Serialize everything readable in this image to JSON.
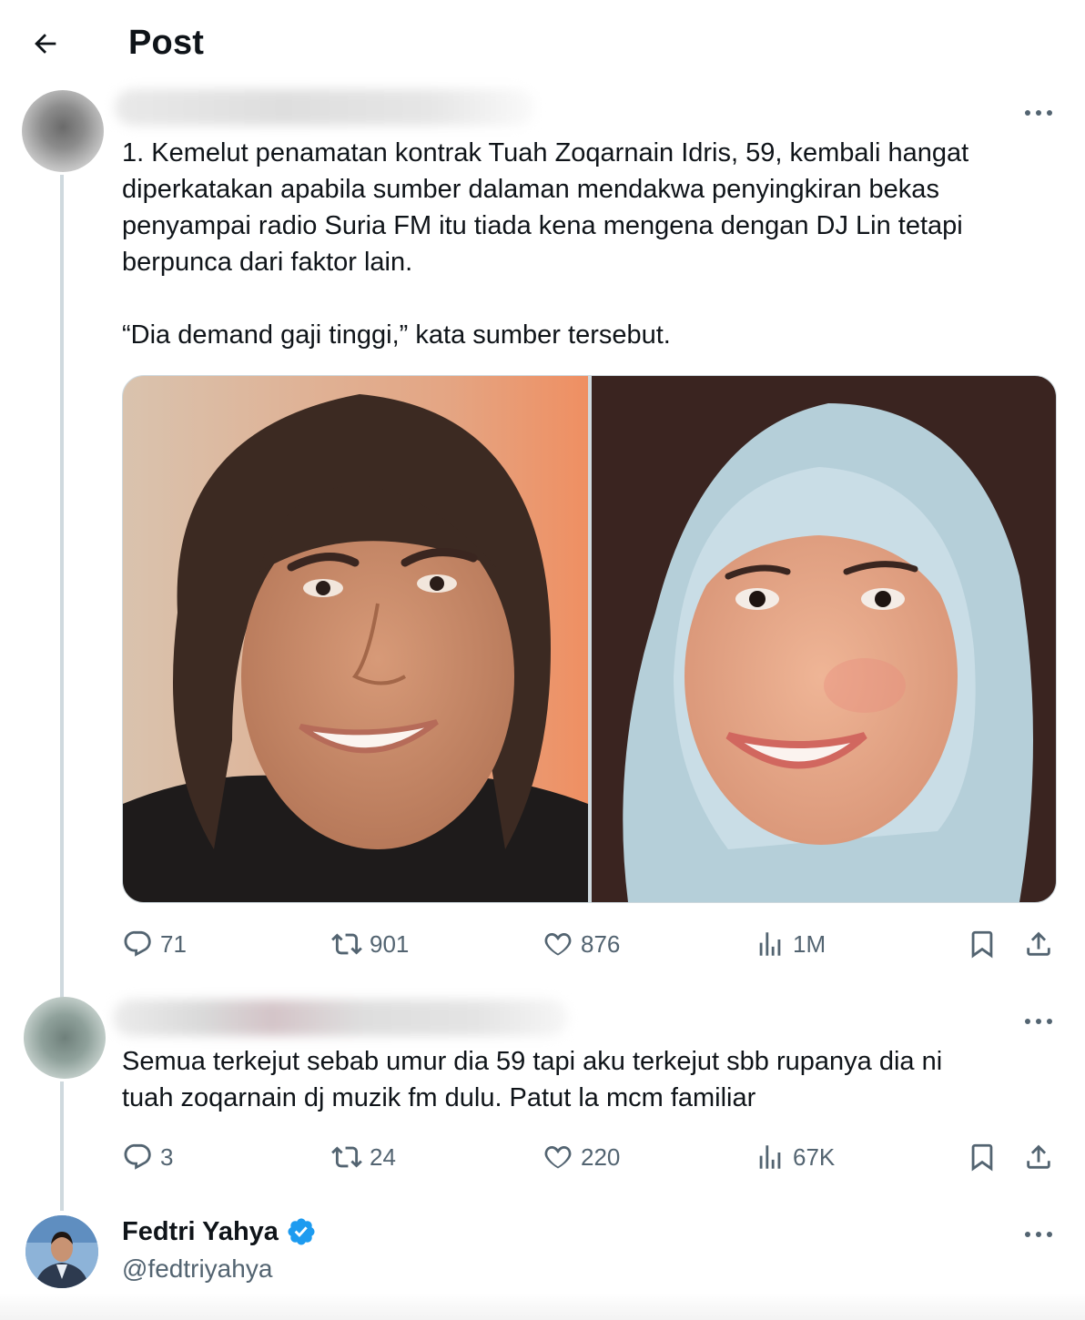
{
  "header": {
    "title": "Post"
  },
  "post1": {
    "text": "1. Kemelut penamatan kontrak Tuah Zoqarnain Idris, 59, kembali hangat\ndiperkatakan apabila sumber dalaman mendakwa penyingkiran bekas\npenyampai radio Suria FM itu tiada kena mengena dengan DJ Lin tetapi\nberpunca dari faktor lain.\n\n“Dia demand gaji tinggi,” kata sumber tersebut.",
    "stats": {
      "replies": "71",
      "reposts": "901",
      "likes": "876",
      "views": "1M"
    }
  },
  "post2": {
    "text": "Semua terkejut sebab umur dia 59 tapi aku terkejut sbb rupanya dia ni\ntuah zoqarnain dj muzik fm dulu. Patut la mcm familiar",
    "stats": {
      "replies": "3",
      "reposts": "24",
      "likes": "220",
      "views": "67K"
    }
  },
  "post3": {
    "name": "Fedtri Yahya",
    "handle": "@fedtriyahya",
    "verified": true
  },
  "colors": {
    "accent": "#1d9bf0",
    "muted": "#536471",
    "text": "#0f1419",
    "line": "#cfd9de"
  }
}
